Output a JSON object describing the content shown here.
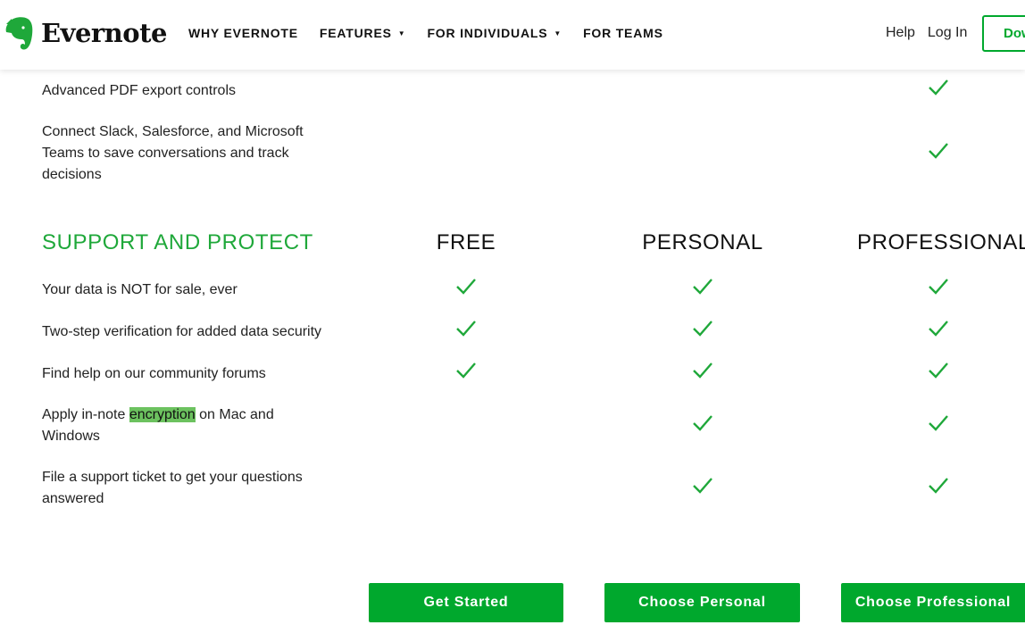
{
  "header": {
    "logo_text": "Evernote",
    "nav": [
      {
        "label": "WHY EVERNOTE",
        "dropdown": false
      },
      {
        "label": "FEATURES",
        "dropdown": true
      },
      {
        "label": "FOR INDIVIDUALS",
        "dropdown": true
      },
      {
        "label": "FOR TEAMS",
        "dropdown": false
      }
    ],
    "dropdown_caret": "▼",
    "help_label": "Help",
    "login_label": "Log In",
    "download_label": "Download"
  },
  "top_rows": [
    {
      "label": "Advanced PDF export controls",
      "free": false,
      "personal": false,
      "professional": true
    },
    {
      "label": "Connect Slack, Salesforce, and Microsoft Teams to save conversations and track decisions",
      "free": false,
      "personal": false,
      "professional": true
    }
  ],
  "support_section": {
    "title": "SUPPORT AND PROTECT",
    "plans": [
      "FREE",
      "PERSONAL",
      "PROFESSIONAL"
    ],
    "rows": [
      {
        "label": "Your data is NOT for sale, ever",
        "free": true,
        "personal": true,
        "professional": true
      },
      {
        "label": "Two-step verification for added data security",
        "free": true,
        "personal": true,
        "professional": true
      },
      {
        "label": "Find help on our community forums",
        "free": true,
        "personal": true,
        "professional": true
      },
      {
        "label_before": "Apply in-note ",
        "label_highlight": "encryption",
        "label_after": " on Mac and Windows",
        "free": false,
        "personal": true,
        "professional": true
      },
      {
        "label": "File a support ticket to get your questions answered",
        "free": false,
        "personal": true,
        "professional": true
      }
    ]
  },
  "cta": {
    "free": "Get Started",
    "personal": "Choose Personal",
    "professional": "Choose Professional"
  },
  "colors": {
    "brand_green": "#00a82d",
    "check_green": "#1fa83a",
    "highlight": "#6cc25f"
  },
  "icons": {
    "logo": "evernote-elephant-icon",
    "check": "checkmark-icon",
    "caret": "caret-down-icon"
  }
}
